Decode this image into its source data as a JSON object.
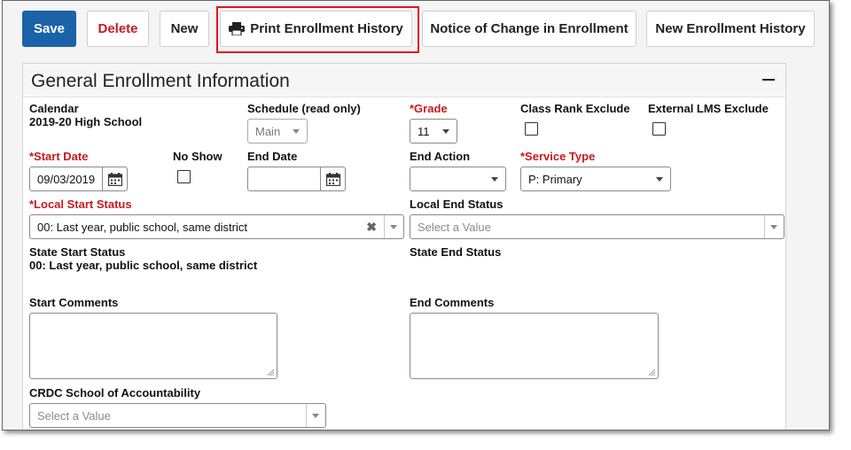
{
  "toolbar": {
    "save": "Save",
    "delete": "Delete",
    "new": "New",
    "print": "Print Enrollment History",
    "notice": "Notice of Change in Enrollment",
    "new_history": "New Enrollment History"
  },
  "panel": {
    "title": "General Enrollment Information"
  },
  "fields": {
    "calendar_label": "Calendar",
    "calendar_value": "2019-20 High School",
    "schedule_label": "Schedule (read only)",
    "schedule_value": "Main",
    "grade_label": "*Grade",
    "grade_value": "11",
    "class_rank_label": "Class Rank Exclude",
    "external_lms_label": "External LMS Exclude",
    "start_date_label": "*Start Date",
    "start_date_value": "09/03/2019",
    "no_show_label": "No Show",
    "end_date_label": "End Date",
    "end_date_value": "",
    "end_action_label": "End Action",
    "end_action_value": "",
    "service_type_label": "*Service Type",
    "service_type_value": "P: Primary",
    "local_start_label": "*Local Start Status",
    "local_start_value": "00: Last year, public school, same district",
    "local_end_label": "Local End Status",
    "local_end_placeholder": "Select a Value",
    "state_start_label": "State Start Status",
    "state_start_value": "00: Last year, public school, same district",
    "state_end_label": "State End Status",
    "start_comments_label": "Start Comments",
    "end_comments_label": "End Comments",
    "crdc_label": "CRDC School of Accountability",
    "crdc_placeholder": "Select a Value"
  },
  "icons": {
    "print": "printer-icon",
    "calendar": "calendar-icon",
    "collapse": "minus-icon",
    "clear": "x-icon"
  },
  "colors": {
    "primary": "#1a63a8",
    "danger": "#c8191e",
    "highlight": "#e3141b"
  }
}
